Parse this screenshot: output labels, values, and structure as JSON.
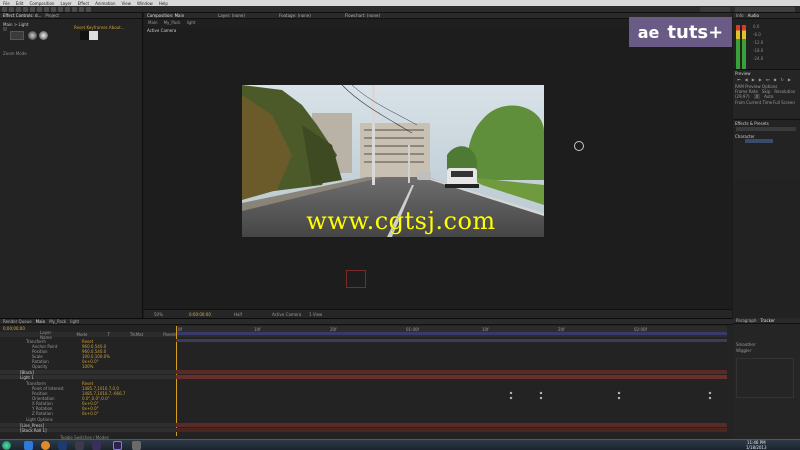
{
  "menubar": {
    "items": [
      "File",
      "Edit",
      "Composition",
      "Layer",
      "Effect",
      "Animation",
      "View",
      "Window",
      "Help"
    ]
  },
  "left_panel": {
    "tabs": [
      "Effect Controls: d...",
      "Project"
    ],
    "tabs_right": [
      "Footage",
      "Composition",
      "Layer"
    ],
    "row1": "Main > Light",
    "row2": "Reset  Keyframes  About...",
    "row3": "Zoom Mode"
  },
  "viewer": {
    "tabs": [
      "Composition: Main",
      "Layer: (none)",
      "Footage: (none)",
      "Flowchart: (none)"
    ],
    "subtabs": [
      "Main",
      "My_Pack",
      "light"
    ],
    "active_camera": "Active Camera",
    "footer": {
      "zoom": "50%",
      "timecode": "0:00:00:00",
      "resolution": "Half",
      "view": "Active Camera",
      "views": "1 View"
    }
  },
  "brand": {
    "ae": "ae",
    "tuts": "tuts+"
  },
  "watermark": "www.cgtsj.com",
  "right_panel": {
    "info_tab": "Info",
    "audio_tab": "Audio",
    "audio_levels": [
      "0.0",
      "-6.0",
      "-12.0",
      "-18.0",
      "-24.0"
    ],
    "preview_title": "Preview",
    "ram_preview": "RAM Preview Options",
    "frame_rate": "Frame Rate",
    "skip": "Skip",
    "resolution": "Resolution",
    "fps": "(29.97)",
    "auto": "Auto",
    "from_current": "From Current Time",
    "full_screen": "Full Screen",
    "effects_title": "Effects & Presets",
    "effects_search": "",
    "character_title": "Character",
    "paragraph_title": "Paragraph",
    "tracker_title": "Tracker",
    "smoother": "Smoother",
    "wiggler": "Wiggler"
  },
  "timeline": {
    "tabs": [
      "Render Queue",
      "Main",
      "My_Pack",
      "light"
    ],
    "timecode": "0;00;00;00",
    "columns": [
      "Layer Name",
      "Mode",
      "T",
      "TrkMat",
      "Parent"
    ],
    "ruler": [
      "0f",
      "10f",
      "20f",
      "01:00f",
      "10f",
      "20f",
      "02:00f"
    ],
    "layers": [
      {
        "name": "Transform",
        "value": "Reset",
        "type": "group"
      },
      {
        "name": "Anchor Point",
        "value": "960.0,540.0",
        "type": "prop"
      },
      {
        "name": "Position",
        "value": "960.0,540.0",
        "type": "prop"
      },
      {
        "name": "Scale",
        "value": "100.0,100.0%",
        "type": "prop"
      },
      {
        "name": "Rotation",
        "value": "0x+0.0°",
        "type": "prop"
      },
      {
        "name": "Opacity",
        "value": "100%",
        "type": "prop"
      },
      {
        "name": "[Black]",
        "value": "",
        "type": "layer"
      },
      {
        "name": "Light 1",
        "value": "",
        "type": "layer"
      },
      {
        "name": "Transform",
        "value": "Reset",
        "type": "group"
      },
      {
        "name": "Point of Interest",
        "value": "1485.7,1010.7,0.0",
        "type": "prop"
      },
      {
        "name": "Position",
        "value": "1485.7,1010.7,-666.7",
        "type": "prop"
      },
      {
        "name": "Orientation",
        "value": "0.0°,0.0°,0.0°",
        "type": "prop"
      },
      {
        "name": "X Rotation",
        "value": "0x+0.0°",
        "type": "prop"
      },
      {
        "name": "Y Rotation",
        "value": "0x+0.0°",
        "type": "prop"
      },
      {
        "name": "Z Rotation",
        "value": "0x+0.0°",
        "type": "prop"
      },
      {
        "name": "Light Options",
        "value": "",
        "type": "group"
      },
      {
        "name": "[Line_Press]",
        "value": "",
        "type": "layer"
      },
      {
        "name": "[Stock Roll 1]",
        "value": "",
        "type": "layer"
      }
    ],
    "footer": "Toggle Switches / Modes"
  },
  "taskbar": {
    "time": "11:46 PM",
    "date": "1/18/2013"
  },
  "colors": {
    "brand_purple": "#6a5a86",
    "watermark_yellow": "#ffff00",
    "layer_red": "#5a2a26"
  }
}
